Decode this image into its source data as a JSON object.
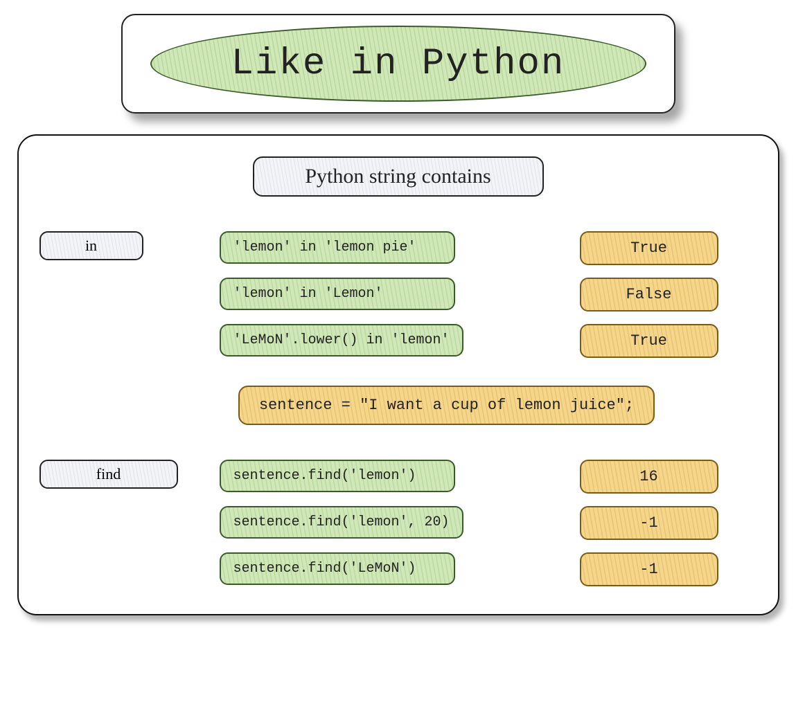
{
  "header": {
    "title": "Like in Python"
  },
  "subtitle": "Python string contains",
  "sections": {
    "in": {
      "label": "in",
      "rows": [
        {
          "code": "'lemon' in 'lemon pie'",
          "result": "True"
        },
        {
          "code": "'lemon' in 'Lemon'",
          "result": "False"
        },
        {
          "code": "'LeMoN'.lower() in 'lemon'",
          "result": "True"
        }
      ]
    },
    "sentence": "sentence = \"I want a cup of lemon juice\";",
    "find": {
      "label": "find",
      "rows": [
        {
          "code": "sentence.find('lemon')",
          "result": "16"
        },
        {
          "code": "sentence.find('lemon', 20)",
          "result": "-1"
        },
        {
          "code": "sentence.find('LeMoN')",
          "result": "-1"
        }
      ]
    }
  }
}
